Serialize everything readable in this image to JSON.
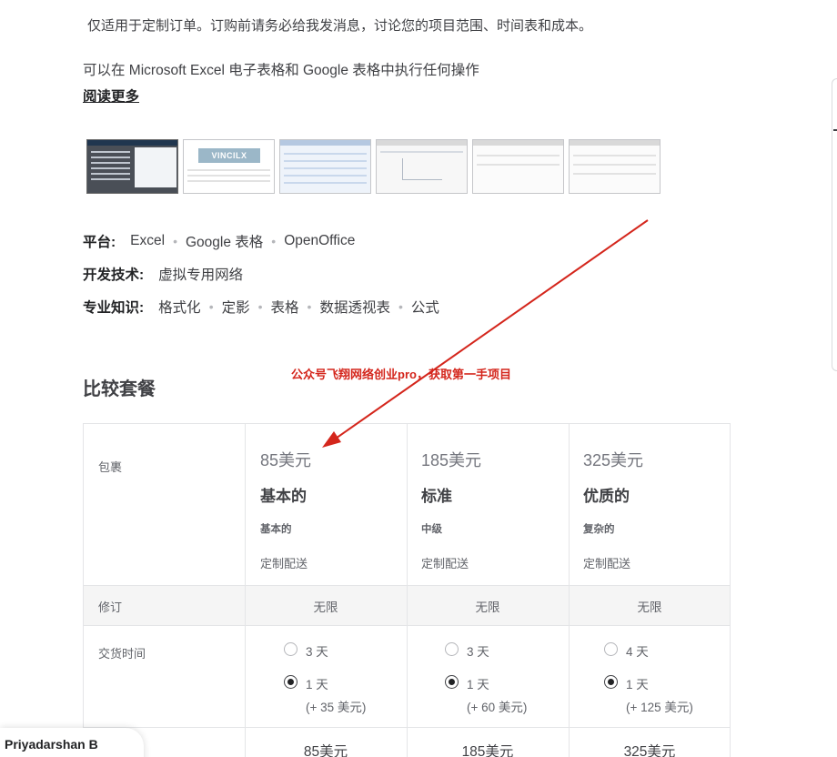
{
  "description": {
    "intro": "仅适用于定制订单。订购前请务必给我发消息，讨论您的项目范围、时间表和成本。",
    "excel_line": "可以在 Microsoft Excel 电子表格和 Google 表格中执行任何操作",
    "read_more": "阅读更多"
  },
  "gallery": {
    "thumb2_logo": "VINCILX"
  },
  "meta": {
    "platform_label": "平台:",
    "platforms": [
      "Excel",
      "Google 表格",
      "OpenOffice"
    ],
    "dev_label": "开发技术:",
    "dev_value": "虚拟专用网络",
    "expertise_label": "专业知识:",
    "expertise": [
      "格式化",
      "定影",
      "表格",
      "数据透视表",
      "公式"
    ]
  },
  "annotation": "公众号飞翔网络创业pro，获取第一手项目",
  "compare": {
    "title": "比较套餐",
    "row_labels": {
      "package": "包裹",
      "revisions": "修订",
      "delivery_time": "交货时间"
    },
    "packages": [
      {
        "price": "85美元",
        "name": "基本的",
        "desc": "基本的",
        "delivery": "定制配送",
        "revisions": "无限",
        "opt1": "3 天",
        "opt2": "1 天",
        "opt2_extra": "(+ 35 美元)",
        "total": "85美元"
      },
      {
        "price": "185美元",
        "name": "标准",
        "desc": "中级",
        "delivery": "定制配送",
        "revisions": "无限",
        "opt1": "3 天",
        "opt2": "1 天",
        "opt2_extra": "(+ 60 美元)",
        "total": "185美元"
      },
      {
        "price": "325美元",
        "name": "优质的",
        "desc": "复杂的",
        "delivery": "定制配送",
        "revisions": "无限",
        "opt1": "4 天",
        "opt2": "1 天",
        "opt2_extra": "(+ 125 美元)",
        "total": "325美元"
      }
    ]
  },
  "chat": {
    "user_name": "Priyadarshan B"
  },
  "colors": {
    "annotation": "#d4261c",
    "text": "#404145",
    "heading": "#222325"
  }
}
